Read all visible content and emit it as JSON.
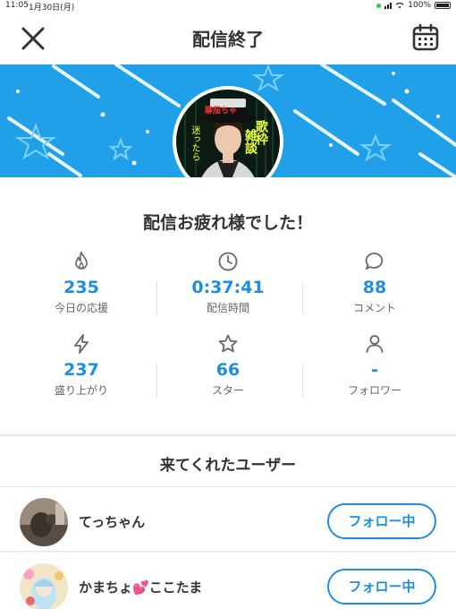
{
  "status_bar": {
    "time": "11:05",
    "date": "1月30日(月)",
    "battery": "100%"
  },
  "nav": {
    "title": "配信終了",
    "close_icon": "close-icon",
    "calendar_icon": "calendar-icon"
  },
  "banner": {
    "avatar_text_top": "聊茄ちゃ",
    "avatar_text_right": "歌枠",
    "avatar_text_mid": "雑談",
    "avatar_text_left": "迷ったら"
  },
  "message": "配信お疲れ様でした！",
  "stats": [
    {
      "icon": "flame-icon",
      "value": "235",
      "label": "今日の応援"
    },
    {
      "icon": "clock-icon",
      "value": "0:37:41",
      "label": "配信時間"
    },
    {
      "icon": "comment-icon",
      "value": "88",
      "label": "コメント"
    },
    {
      "icon": "lightning-icon",
      "value": "237",
      "label": "盛り上がり"
    },
    {
      "icon": "star-icon",
      "value": "66",
      "label": "スター"
    },
    {
      "icon": "person-icon",
      "value": "-",
      "label": "フォロワー"
    }
  ],
  "users_section": {
    "title": "来てくれたユーザー",
    "users": [
      {
        "name": "てっちゃん",
        "button": "フォロー中"
      },
      {
        "name": "かまちょ💕ここたま",
        "button": "フォロー中"
      }
    ]
  },
  "colors": {
    "accent": "#1e8fe0",
    "banner": "#1fa0e8"
  }
}
